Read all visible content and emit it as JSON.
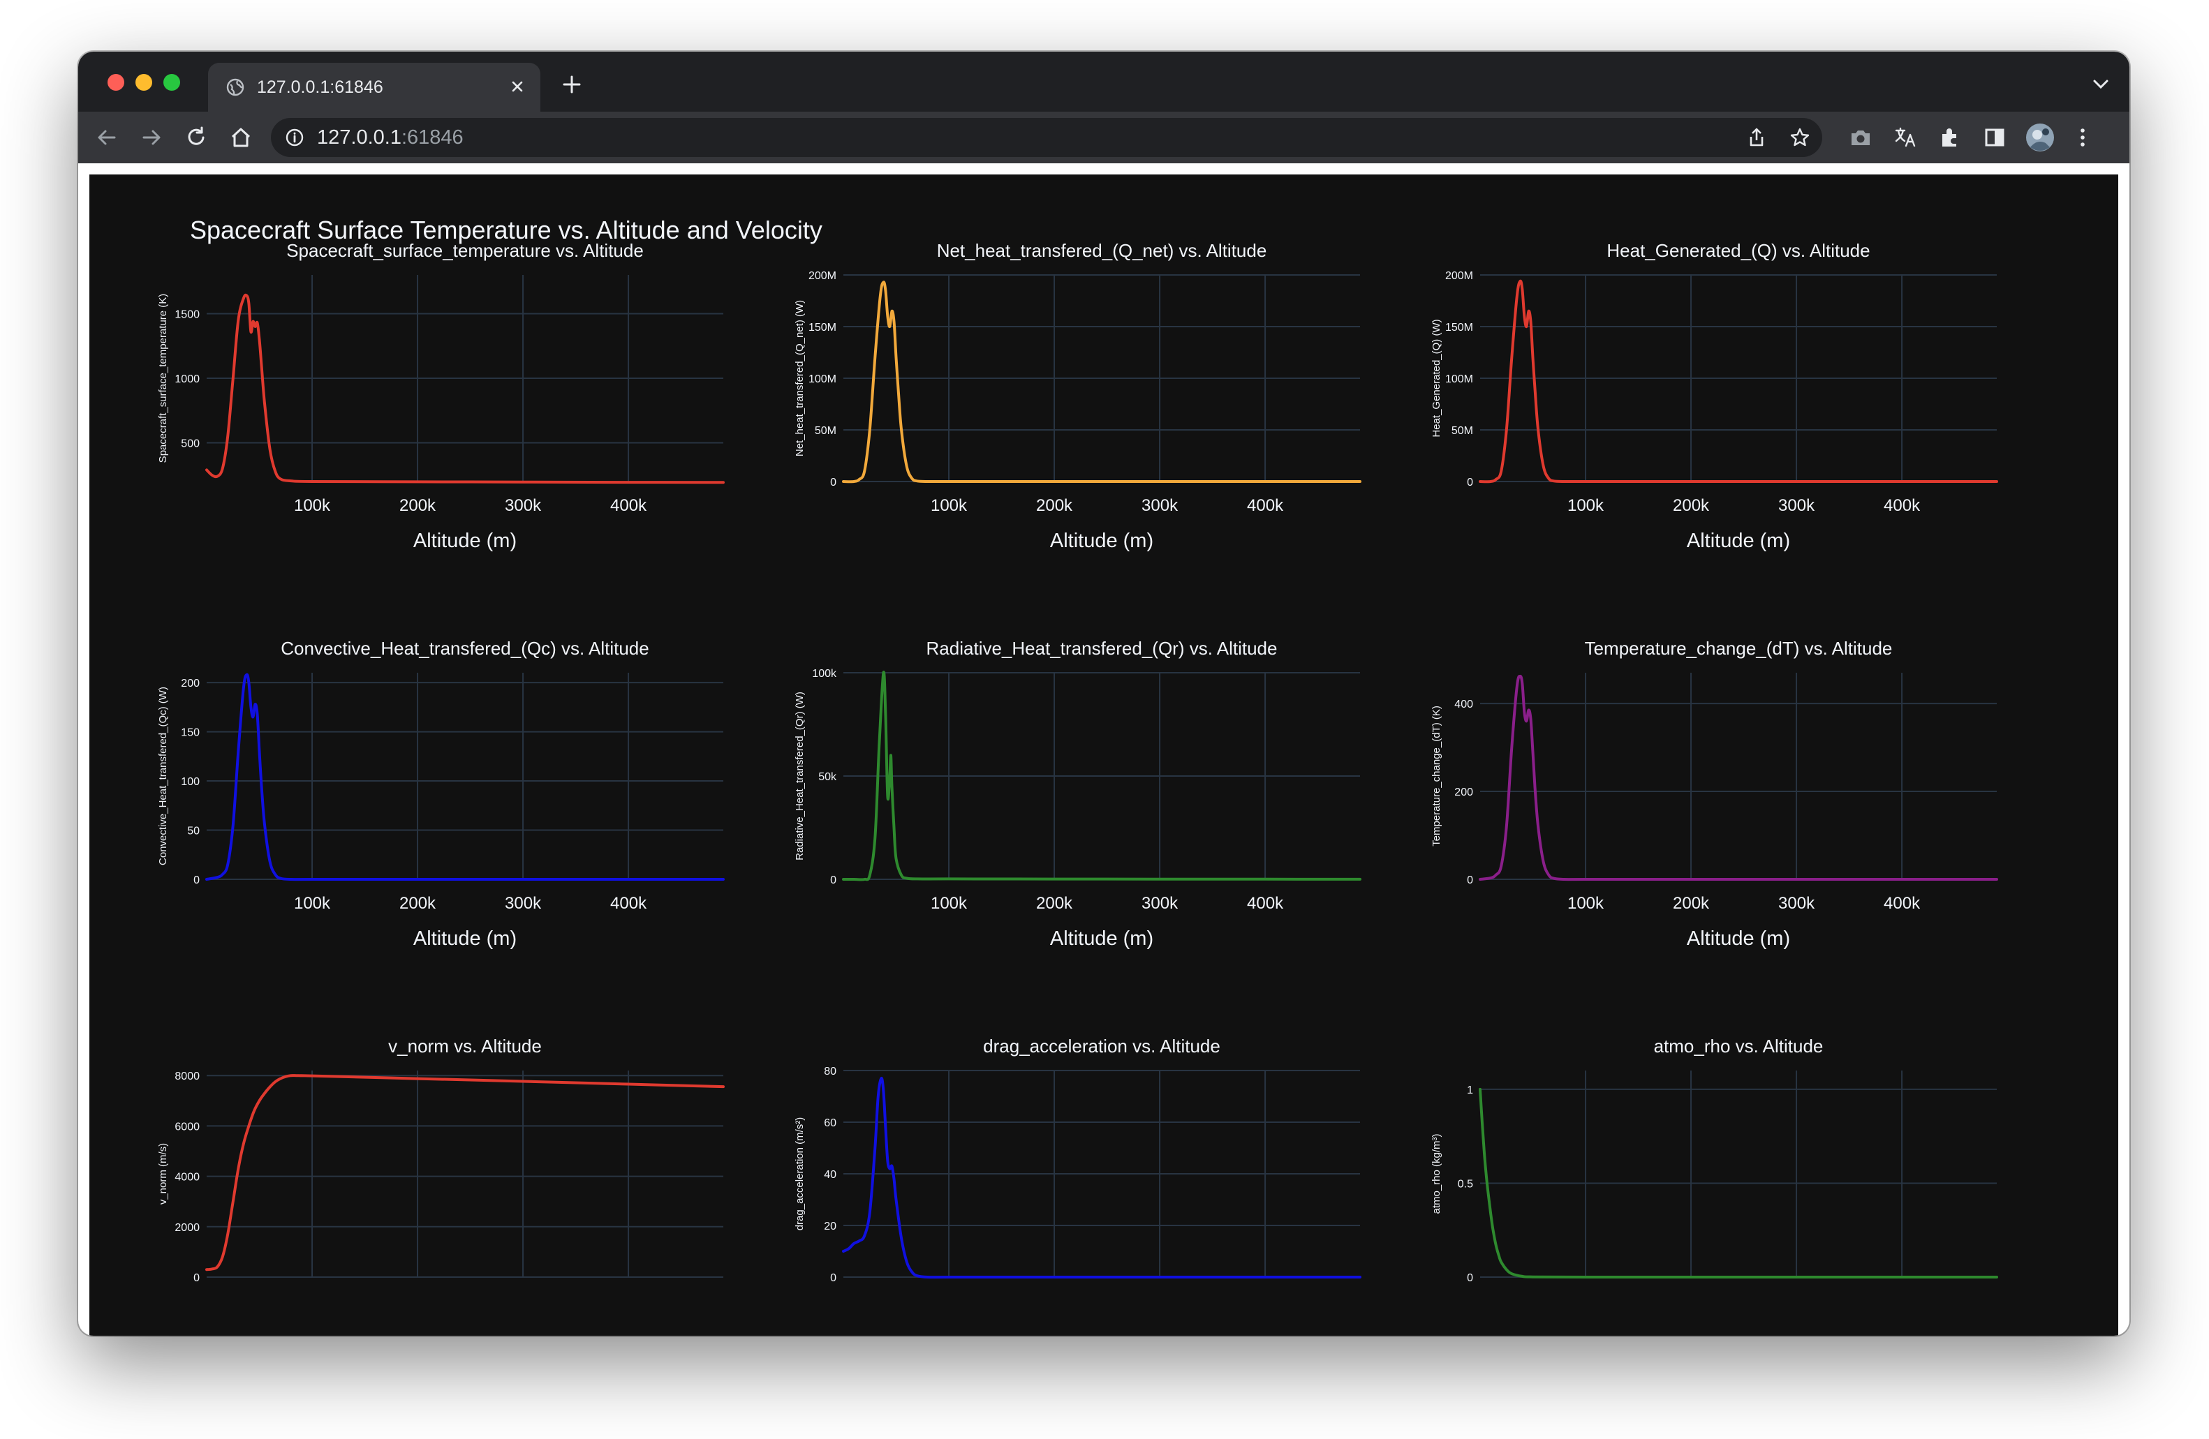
{
  "browser": {
    "tab_title": "127.0.0.1:61846",
    "url_host": "127.0.0.1",
    "url_port": ":61846"
  },
  "page": {
    "title": "Spacecraft Surface Temperature vs. Altitude and Velocity"
  },
  "colors": {
    "background": "#111111",
    "grid": "#283442",
    "text": "#f2f5fa",
    "red": "#e03a2f",
    "orange": "#f2a93b",
    "blue": "#1010e0",
    "green": "#2e8a2e",
    "purple": "#8a1f8a"
  },
  "chart_data": [
    {
      "type": "line",
      "title": "Spacecraft_surface_temperature vs. Altitude",
      "xlabel": "Altitude (m)",
      "ylabel": "Spacecraft_surface_temperature (K)",
      "xlim": [
        0,
        490000
      ],
      "ylim": [
        200,
        1800
      ],
      "xticks": [
        100000,
        200000,
        300000,
        400000
      ],
      "xtick_labels": [
        "100k",
        "200k",
        "300k",
        "400k"
      ],
      "yticks": [
        500,
        1000,
        1500
      ],
      "ytick_labels": [
        "500",
        "1000",
        "1500"
      ],
      "color": "#e03a2f",
      "grid": true,
      "series": [
        {
          "x": [
            0,
            5000,
            10000,
            15000,
            20000,
            25000,
            30000,
            35000,
            38000,
            40000,
            42000,
            44000,
            46000,
            48000,
            50000,
            52000,
            55000,
            60000,
            65000,
            70000,
            80000,
            100000,
            200000,
            300000,
            400000,
            490000
          ],
          "values": [
            290,
            250,
            240,
            300,
            550,
            1000,
            1450,
            1620,
            1640,
            1580,
            1360,
            1440,
            1400,
            1430,
            1300,
            1100,
            800,
            450,
            280,
            220,
            205,
            200,
            198,
            196,
            194,
            193
          ]
        }
      ]
    },
    {
      "type": "line",
      "title": "Net_heat_transfered_(Q_net) vs. Altitude",
      "xlabel": "Altitude (m)",
      "ylabel": "Net_heat_transfered_(Q_net) (W)",
      "xlim": [
        0,
        490000
      ],
      "ylim": [
        0,
        200000000
      ],
      "xticks": [
        100000,
        200000,
        300000,
        400000
      ],
      "xtick_labels": [
        "100k",
        "200k",
        "300k",
        "400k"
      ],
      "yticks": [
        0,
        50000000,
        100000000,
        150000000,
        200000000
      ],
      "ytick_labels": [
        "0",
        "50M",
        "100M",
        "150M",
        "200M"
      ],
      "color": "#f2a93b",
      "grid": true,
      "series": [
        {
          "x": [
            0,
            10000,
            15000,
            20000,
            25000,
            30000,
            35000,
            38000,
            40000,
            42000,
            44000,
            46000,
            48000,
            50000,
            52000,
            55000,
            60000,
            65000,
            70000,
            80000,
            100000,
            200000,
            300000,
            400000,
            490000
          ],
          "values": [
            0,
            0,
            2000000,
            10000000,
            50000000,
            120000000,
            180000000,
            193000000,
            185000000,
            160000000,
            150000000,
            165000000,
            155000000,
            120000000,
            90000000,
            50000000,
            15000000,
            3000000,
            500000,
            0,
            0,
            0,
            0,
            0,
            0
          ]
        }
      ]
    },
    {
      "type": "line",
      "title": "Heat_Generated_(Q) vs. Altitude",
      "xlabel": "Altitude (m)",
      "ylabel": "Heat_Generated_(Q) (W)",
      "xlim": [
        0,
        490000
      ],
      "ylim": [
        0,
        200000000
      ],
      "xticks": [
        100000,
        200000,
        300000,
        400000
      ],
      "xtick_labels": [
        "100k",
        "200k",
        "300k",
        "400k"
      ],
      "yticks": [
        0,
        50000000,
        100000000,
        150000000,
        200000000
      ],
      "ytick_labels": [
        "0",
        "50M",
        "100M",
        "150M",
        "200M"
      ],
      "color": "#e03a2f",
      "grid": true,
      "series": [
        {
          "x": [
            0,
            10000,
            15000,
            20000,
            25000,
            30000,
            35000,
            38000,
            40000,
            42000,
            44000,
            46000,
            48000,
            50000,
            52000,
            55000,
            60000,
            65000,
            70000,
            80000,
            100000,
            200000,
            300000,
            400000,
            490000
          ],
          "values": [
            0,
            0,
            2000000,
            10000000,
            50000000,
            120000000,
            180000000,
            194000000,
            186000000,
            160000000,
            150000000,
            165000000,
            155000000,
            120000000,
            90000000,
            50000000,
            15000000,
            3000000,
            500000,
            0,
            0,
            0,
            0,
            0,
            0
          ]
        }
      ]
    },
    {
      "type": "line",
      "title": "Convective_Heat_transfered_(Qc) vs. Altitude",
      "xlabel": "Altitude (m)",
      "ylabel": "Convective_Heat_transfered_(Qc) (W)",
      "xlim": [
        0,
        490000
      ],
      "ylim": [
        0,
        210
      ],
      "xticks": [
        100000,
        200000,
        300000,
        400000
      ],
      "xtick_labels": [
        "100k",
        "200k",
        "300k",
        "400k"
      ],
      "yticks": [
        0,
        50,
        100,
        150,
        200
      ],
      "ytick_labels": [
        "0",
        "50",
        "100",
        "150",
        "200"
      ],
      "color": "#1010e0",
      "grid": true,
      "series": [
        {
          "x": [
            0,
            10000,
            15000,
            20000,
            25000,
            30000,
            35000,
            38000,
            40000,
            42000,
            44000,
            46000,
            48000,
            50000,
            52000,
            55000,
            60000,
            65000,
            70000,
            80000,
            100000,
            200000,
            300000,
            400000,
            490000
          ],
          "values": [
            0,
            2,
            5,
            15,
            55,
            130,
            195,
            208,
            200,
            175,
            165,
            178,
            168,
            130,
            95,
            55,
            18,
            5,
            1,
            0,
            0,
            0,
            0,
            0,
            0
          ]
        }
      ]
    },
    {
      "type": "line",
      "title": "Radiative_Heat_transfered_(Qr) vs. Altitude",
      "xlabel": "Altitude (m)",
      "ylabel": "Radiative_Heat_transfered_(Qr) (W)",
      "xlim": [
        0,
        490000
      ],
      "ylim": [
        0,
        100000
      ],
      "xticks": [
        100000,
        200000,
        300000,
        400000
      ],
      "xtick_labels": [
        "100k",
        "200k",
        "300k",
        "400k"
      ],
      "yticks": [
        0,
        50000,
        100000
      ],
      "ytick_labels": [
        "0",
        "50k",
        "100k"
      ],
      "color": "#2e8a2e",
      "grid": true,
      "series": [
        {
          "x": [
            0,
            10000,
            20000,
            25000,
            30000,
            34000,
            38000,
            40000,
            42000,
            44000,
            45000,
            46000,
            48000,
            50000,
            55000,
            60000,
            70000,
            100000,
            200000,
            300000,
            400000,
            490000
          ],
          "values": [
            0,
            0,
            0,
            2000,
            20000,
            65000,
            100000,
            80000,
            40000,
            50000,
            60000,
            45000,
            25000,
            10000,
            2000,
            500,
            200,
            200,
            150,
            100,
            60,
            40
          ]
        }
      ]
    },
    {
      "type": "line",
      "title": "Temperature_change_(dT) vs. Altitude",
      "xlabel": "Altitude (m)",
      "ylabel": "Temperature_change_(dT) (K)",
      "xlim": [
        0,
        490000
      ],
      "ylim": [
        0,
        470
      ],
      "xticks": [
        100000,
        200000,
        300000,
        400000
      ],
      "xtick_labels": [
        "100k",
        "200k",
        "300k",
        "400k"
      ],
      "yticks": [
        0,
        200,
        400
      ],
      "ytick_labels": [
        "0",
        "200",
        "400"
      ],
      "color": "#8a1f8a",
      "grid": true,
      "series": [
        {
          "x": [
            0,
            10000,
            15000,
            20000,
            25000,
            30000,
            35000,
            38000,
            40000,
            42000,
            44000,
            46000,
            48000,
            50000,
            52000,
            55000,
            60000,
            65000,
            70000,
            80000,
            100000,
            200000,
            300000,
            400000,
            490000
          ],
          "values": [
            0,
            3,
            10,
            30,
            120,
            300,
            440,
            462,
            445,
            380,
            360,
            385,
            365,
            290,
            210,
            120,
            40,
            10,
            2,
            0,
            0,
            0,
            0,
            0,
            0
          ]
        }
      ]
    },
    {
      "type": "line",
      "title": "v_norm vs. Altitude",
      "xlabel": "",
      "ylabel": "v_norm (m/s)",
      "xlim": [
        0,
        490000
      ],
      "ylim": [
        0,
        8200
      ],
      "xticks": [
        100000,
        200000,
        300000,
        400000
      ],
      "xtick_labels": [],
      "yticks": [
        0,
        2000,
        4000,
        6000,
        8000
      ],
      "ytick_labels": [
        "0",
        "2000",
        "4000",
        "6000",
        "8000"
      ],
      "color": "#e03a2f",
      "grid": true,
      "series": [
        {
          "x": [
            0,
            5000,
            10000,
            15000,
            20000,
            25000,
            30000,
            35000,
            40000,
            45000,
            50000,
            55000,
            60000,
            65000,
            70000,
            75000,
            80000,
            85000,
            90000,
            100000,
            200000,
            300000,
            400000,
            490000
          ],
          "values": [
            300,
            320,
            400,
            800,
            1700,
            3000,
            4300,
            5300,
            6000,
            6600,
            7000,
            7300,
            7550,
            7750,
            7880,
            7960,
            8000,
            8000,
            7995,
            7990,
            7880,
            7770,
            7660,
            7560
          ]
        }
      ]
    },
    {
      "type": "line",
      "title": "drag_acceleration vs. Altitude",
      "xlabel": "",
      "ylabel": "drag_acceleration (m/s²)",
      "xlim": [
        0,
        490000
      ],
      "ylim": [
        0,
        80
      ],
      "xticks": [
        100000,
        200000,
        300000,
        400000
      ],
      "xtick_labels": [],
      "yticks": [
        0,
        20,
        40,
        60,
        80
      ],
      "ytick_labels": [
        "0",
        "20",
        "40",
        "60",
        "80"
      ],
      "color": "#1010e0",
      "grid": true,
      "series": [
        {
          "x": [
            0,
            5000,
            10000,
            15000,
            20000,
            25000,
            30000,
            33000,
            36000,
            38000,
            40000,
            42000,
            44000,
            46000,
            48000,
            50000,
            55000,
            60000,
            65000,
            70000,
            80000,
            100000,
            200000,
            300000,
            400000,
            490000
          ],
          "values": [
            10,
            11,
            13,
            14,
            16,
            25,
            50,
            70,
            77,
            72,
            58,
            45,
            42,
            43,
            38,
            30,
            15,
            6,
            2,
            0.5,
            0,
            0,
            0,
            0,
            0,
            0
          ]
        }
      ]
    },
    {
      "type": "line",
      "title": "atmo_rho vs. Altitude",
      "xlabel": "",
      "ylabel": "atmo_rho (kg/m³)",
      "xlim": [
        0,
        490000
      ],
      "ylim": [
        0,
        1.1
      ],
      "xticks": [
        100000,
        200000,
        300000,
        400000
      ],
      "xtick_labels": [],
      "yticks": [
        0,
        0.5,
        1
      ],
      "ytick_labels": [
        "0",
        "0.5",
        "1"
      ],
      "color": "#2e8a2e",
      "grid": true,
      "series": [
        {
          "x": [
            0,
            2000,
            4000,
            6000,
            8000,
            10000,
            12000,
            15000,
            18000,
            20000,
            25000,
            30000,
            40000,
            50000,
            100000,
            200000,
            300000,
            400000,
            490000
          ],
          "values": [
            1.0,
            0.82,
            0.66,
            0.53,
            0.43,
            0.34,
            0.26,
            0.17,
            0.11,
            0.08,
            0.04,
            0.018,
            0.004,
            0.001,
            0,
            0,
            0,
            0,
            0
          ]
        }
      ]
    }
  ]
}
